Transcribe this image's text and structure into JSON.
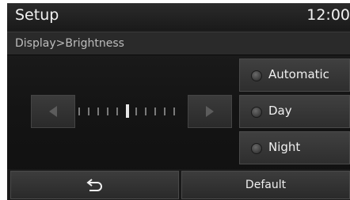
{
  "header": {
    "title": "Setup",
    "clock": "12:00"
  },
  "breadcrumb": "Display>Brightness",
  "brightness": {
    "level": 5,
    "ticks": 11,
    "left_icon": "arrow-left-icon",
    "right_icon": "arrow-right-icon"
  },
  "options": [
    {
      "label": "Automatic"
    },
    {
      "label": "Day"
    },
    {
      "label": "Night"
    }
  ],
  "footer": {
    "back_icon": "return-icon",
    "default_label": "Default"
  },
  "colors": {
    "background": "#141414",
    "button": "#363636",
    "text": "#f0f0f0"
  }
}
